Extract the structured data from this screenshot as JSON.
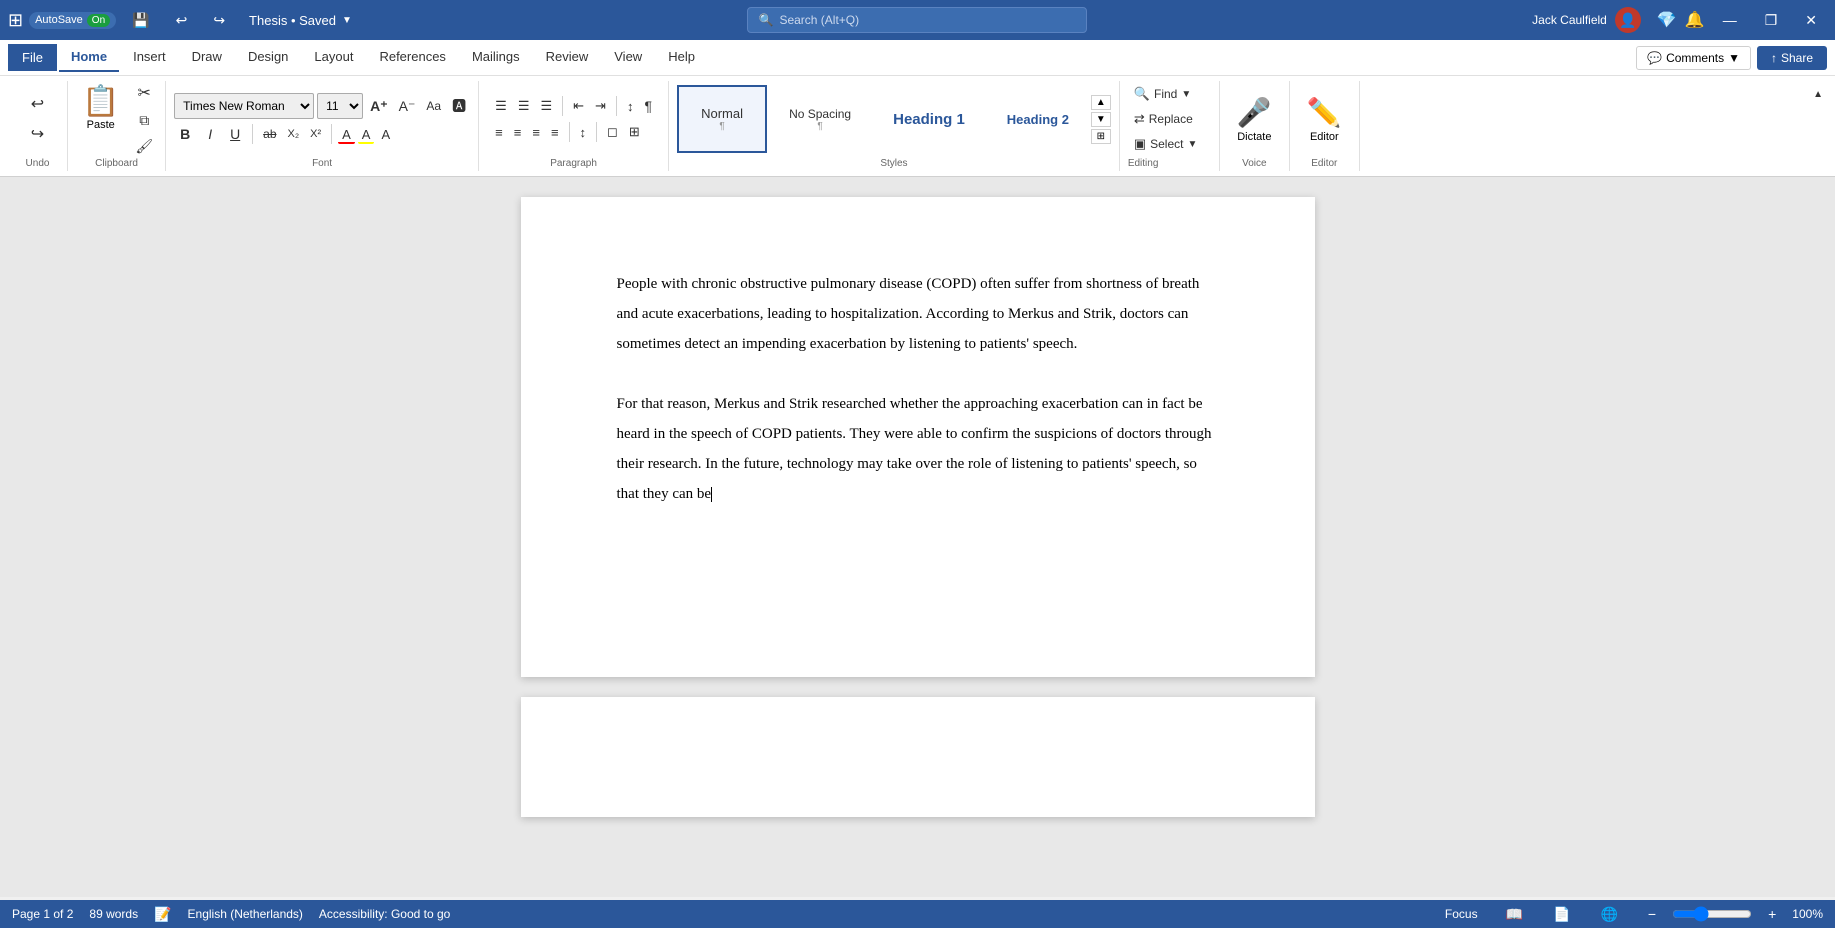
{
  "titleBar": {
    "autosave": "AutoSave",
    "autosave_state": "On",
    "save_icon": "💾",
    "title": "Thesis • Saved",
    "search_placeholder": "Search (Alt+Q)",
    "user": "Jack Caulfield",
    "minimize": "—",
    "restore": "❐",
    "close": "✕"
  },
  "tabs": {
    "file": "File",
    "home": "Home",
    "insert": "Insert",
    "draw": "Draw",
    "design": "Design",
    "layout": "Layout",
    "references": "References",
    "mailings": "Mailings",
    "review": "Review",
    "view": "View",
    "help": "Help",
    "comments": "Comments",
    "share": "Share"
  },
  "toolbar": {
    "undo_label": "Undo",
    "clipboard_label": "Clipboard",
    "font_label": "Font",
    "paragraph_label": "Paragraph",
    "styles_label": "Styles",
    "editing_label": "Editing",
    "voice_label": "Voice",
    "editor_label": "Editor",
    "font_name": "Times New Roman",
    "font_size": "11",
    "paste": "Paste",
    "bold": "B",
    "italic": "I",
    "underline": "U",
    "strikethrough": "ab",
    "subscript": "X₂",
    "superscript": "X²",
    "font_color": "A",
    "highlight": "A",
    "font_grow": "A↑",
    "font_shrink": "A↓",
    "change_case": "Aa",
    "clear_format": "✗",
    "bullets": "☰",
    "numbering": "☰#",
    "multilevel": "☰≡",
    "indent_dec": "⇤",
    "indent_inc": "⇥",
    "sort": "↕A",
    "show_para": "¶",
    "align_left": "≡",
    "align_center": "≡",
    "align_right": "≡",
    "justify": "≡",
    "line_spacing": "↕",
    "shading": "◻",
    "borders": "⊞",
    "find": "Find",
    "replace": "Replace",
    "select": "Select",
    "dictate": "Dictate",
    "editor": "Editor"
  },
  "styles": {
    "normal": "Normal",
    "no_spacing": "No Spacing",
    "heading1": "Heading 1",
    "heading2": "Heading 2"
  },
  "document": {
    "paragraph1": "People with chronic obstructive pulmonary disease (COPD) often suffer from shortness of breath and acute exacerbations, leading to hospitalization. According to Merkus and Strik, doctors can sometimes detect an impending exacerbation by listening to patients' speech.",
    "paragraph2": "For that reason, Merkus and Strik researched whether the approaching exacerbation can in fact be heard in the speech of COPD patients. They were able to confirm the suspicions of doctors through their research. In the future, technology may take over the role of listening to patients' speech, so that they can be"
  },
  "statusBar": {
    "page": "Page 1 of 2",
    "words": "89 words",
    "language": "English (Netherlands)",
    "accessibility": "Accessibility: Good to go",
    "focus": "Focus",
    "zoom": "100%"
  }
}
